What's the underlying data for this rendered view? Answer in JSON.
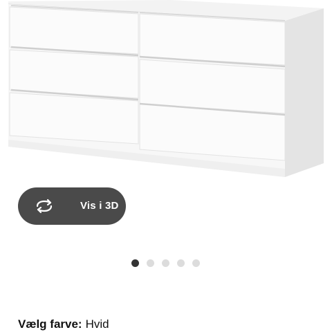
{
  "product": {
    "image_alt": "6-drawer chest, white"
  },
  "view_3d": {
    "icon": "rotate-3d-icon",
    "label": "Vis i 3D"
  },
  "carousel": {
    "total": 5,
    "active_index": 0
  },
  "color_selector": {
    "label": "Vælg farve:",
    "value": "Hvid"
  },
  "colors": {
    "button_bg": "#4a4a4a",
    "dot_active": "#333333",
    "dot_inactive": "#dcdcdc"
  }
}
